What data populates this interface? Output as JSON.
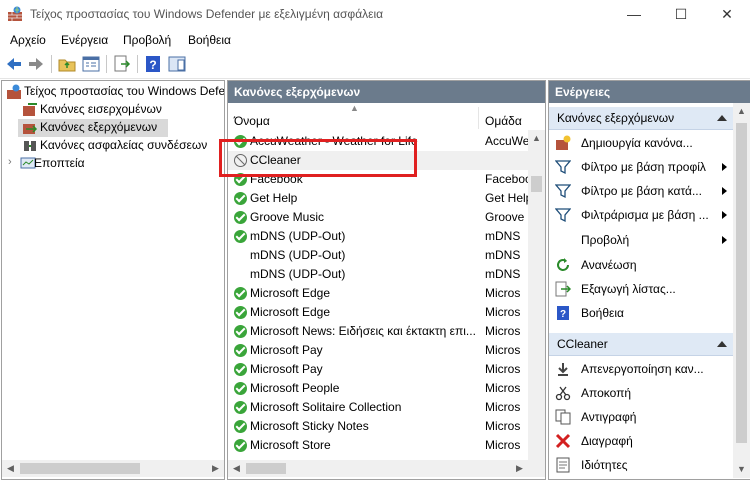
{
  "window": {
    "title": "Τείχος προστασίας του Windows Defender με εξελιγμένη ασφάλεια",
    "minimize": "—",
    "maximize": "☐",
    "close": "✕"
  },
  "menu": [
    "Αρχείο",
    "Ενέργεια",
    "Προβολή",
    "Βοήθεια"
  ],
  "tree": {
    "root": "Τείχος προστασίας του Windows Defender",
    "items": [
      "Κανόνες εισερχομένων",
      "Κανόνες εξερχόμενων",
      "Κανόνες ασφαλείας συνδέσεων",
      "Εποπτεία"
    ],
    "selected_index": 1
  },
  "rules_pane": {
    "header": "Κανόνες εξερχόμενων",
    "columns": [
      "Όνομα",
      "Ομάδα"
    ],
    "rows": [
      {
        "name": "AccuWeather - Weather for Life",
        "group": "AccuWe",
        "status": "enabled"
      },
      {
        "name": "CCleaner",
        "group": "",
        "status": "blocked"
      },
      {
        "name": "Facebook",
        "group": "Faceboo",
        "status": "enabled"
      },
      {
        "name": "Get Help",
        "group": "Get Help",
        "status": "enabled"
      },
      {
        "name": "Groove Music",
        "group": "Groove",
        "status": "enabled"
      },
      {
        "name": "mDNS (UDP-Out)",
        "group": "mDNS",
        "status": "enabled"
      },
      {
        "name": "mDNS (UDP-Out)",
        "group": "mDNS",
        "status": "none"
      },
      {
        "name": "mDNS (UDP-Out)",
        "group": "mDNS",
        "status": "none"
      },
      {
        "name": "Microsoft Edge",
        "group": "Micros",
        "status": "enabled"
      },
      {
        "name": "Microsoft Edge",
        "group": "Micros",
        "status": "enabled"
      },
      {
        "name": "Microsoft News: Ειδήσεις και έκτακτη επι...",
        "group": "Micros",
        "status": "enabled"
      },
      {
        "name": "Microsoft Pay",
        "group": "Micros",
        "status": "enabled"
      },
      {
        "name": "Microsoft Pay",
        "group": "Micros",
        "status": "enabled"
      },
      {
        "name": "Microsoft People",
        "group": "Micros",
        "status": "enabled"
      },
      {
        "name": "Microsoft Solitaire Collection",
        "group": "Micros",
        "status": "enabled"
      },
      {
        "name": "Microsoft Sticky Notes",
        "group": "Micros",
        "status": "enabled"
      },
      {
        "name": "Microsoft Store",
        "group": "Micros",
        "status": "enabled"
      }
    ]
  },
  "actions_pane": {
    "header": "Ενέργειες",
    "section1": {
      "title": "Κανόνες εξερχόμενων",
      "items": [
        {
          "label": "Δημιουργία κανόνα...",
          "icon": "new-rule-icon",
          "submenu": false
        },
        {
          "label": "Φίλτρο με βάση προφίλ",
          "icon": "filter-icon",
          "submenu": true
        },
        {
          "label": "Φίλτρο με βάση κατά...",
          "icon": "filter-icon",
          "submenu": true
        },
        {
          "label": "Φιλτράρισμα με βάση ...",
          "icon": "filter-icon",
          "submenu": true
        },
        {
          "label": "Προβολή",
          "icon": "",
          "submenu": true
        },
        {
          "label": "Ανανέωση",
          "icon": "refresh-icon",
          "submenu": false
        },
        {
          "label": "Εξαγωγή λίστας...",
          "icon": "export-icon",
          "submenu": false
        },
        {
          "label": "Βοήθεια",
          "icon": "help-icon",
          "submenu": false
        }
      ]
    },
    "section2": {
      "title": "CCleaner",
      "items": [
        {
          "label": "Απενεργοποίηση καν...",
          "icon": "disable-icon"
        },
        {
          "label": "Αποκοπή",
          "icon": "cut-icon"
        },
        {
          "label": "Αντιγραφή",
          "icon": "copy-icon"
        },
        {
          "label": "Διαγραφή",
          "icon": "delete-icon"
        },
        {
          "label": "Ιδιότητες",
          "icon": "properties-icon"
        }
      ]
    }
  },
  "colors": {
    "header_bg": "#6b7b8c",
    "action_header_bg": "#dfe9f5",
    "highlight": "#e02020",
    "enabled_green": "#3aa53a"
  }
}
